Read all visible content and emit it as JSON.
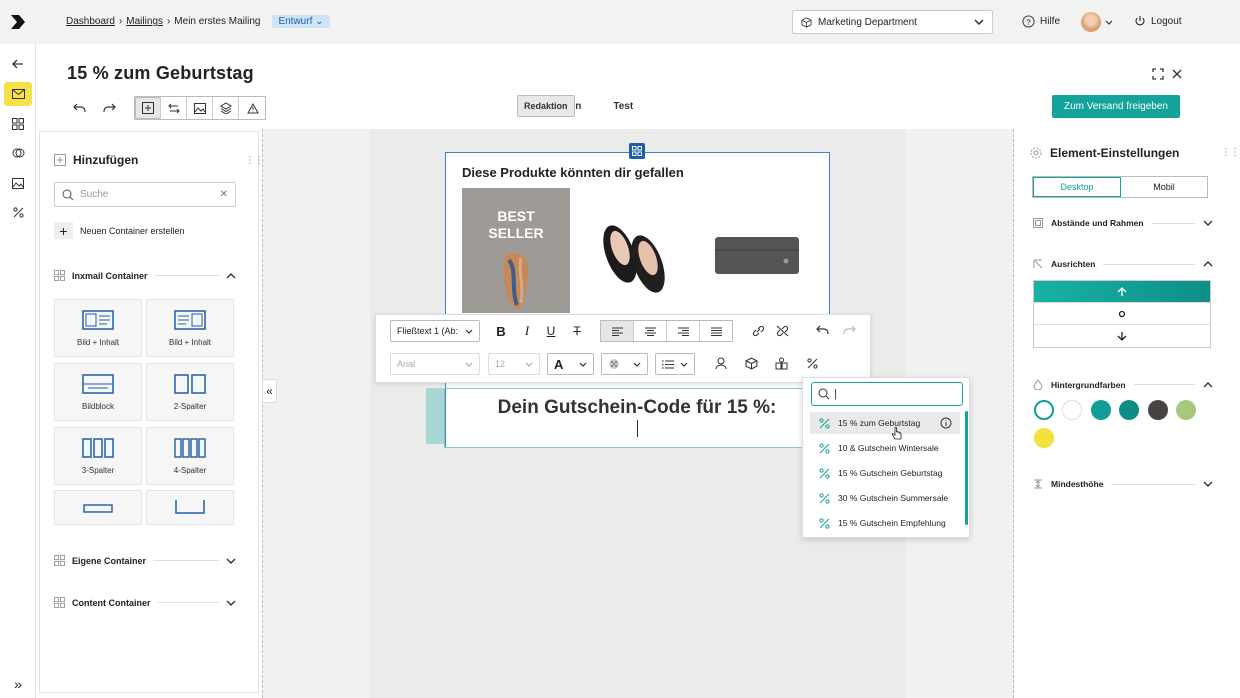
{
  "breadcrumb": {
    "dashboard": "Dashboard",
    "mailings": "Mailings",
    "current": "Mein erstes Mailing",
    "status": "Entwurf"
  },
  "header": {
    "department": "Marketing Department",
    "help": "Hilfe",
    "logout": "Logout"
  },
  "page": {
    "title": "15 % zum Geburtstag"
  },
  "tabs": [
    "Redaktion",
    "Redaktion",
    "Test"
  ],
  "send_button": "Zum Versand freigeben",
  "left_panel": {
    "title": "Hinzufügen",
    "search_placeholder": "Suche",
    "new_container": "Neuen Container erstellen",
    "sections": {
      "inxmail": "Inxmail Container",
      "own": "Eigene Container",
      "content": "Content Container"
    },
    "tiles": [
      "Bild + Inhalt",
      "Bild + Inhalt",
      "Bildblock",
      "2-Spalter",
      "3-Spalter",
      "4-Spalter"
    ]
  },
  "mail": {
    "products_title": "Diese Produkte könnten dir gefallen",
    "bestseller": "BEST SELLER",
    "voucher_heading": "Dein Gutschein-Code für 15 %:"
  },
  "editor_toolbar": {
    "paragraph_style": "Fließtext 1 (Ab:",
    "font": "Arial",
    "font_size": "12"
  },
  "voucher_dropdown": {
    "items": [
      "15 % zum Geburtstag",
      "10 & Gutschein Wintersale",
      "15 % Gutschein Geburtstag",
      "30 % Gutschein Summersale",
      "15 % Gutschein Empfehlung"
    ]
  },
  "right_panel": {
    "title": "Element-Einstellungen",
    "devices": [
      "Desktop",
      "Mobil"
    ],
    "sections": {
      "spacing": "Abstände und Rahmen",
      "align": "Ausrichten",
      "bg": "Hintergrundfarben",
      "minheight": "Mindesthöhe"
    },
    "colors": [
      "#ffffff",
      "#ffffff",
      "#129e97",
      "#0e8d86",
      "#4a4141",
      "#a7c87c",
      "#f4e13c"
    ]
  },
  "accent": "#14a39a"
}
